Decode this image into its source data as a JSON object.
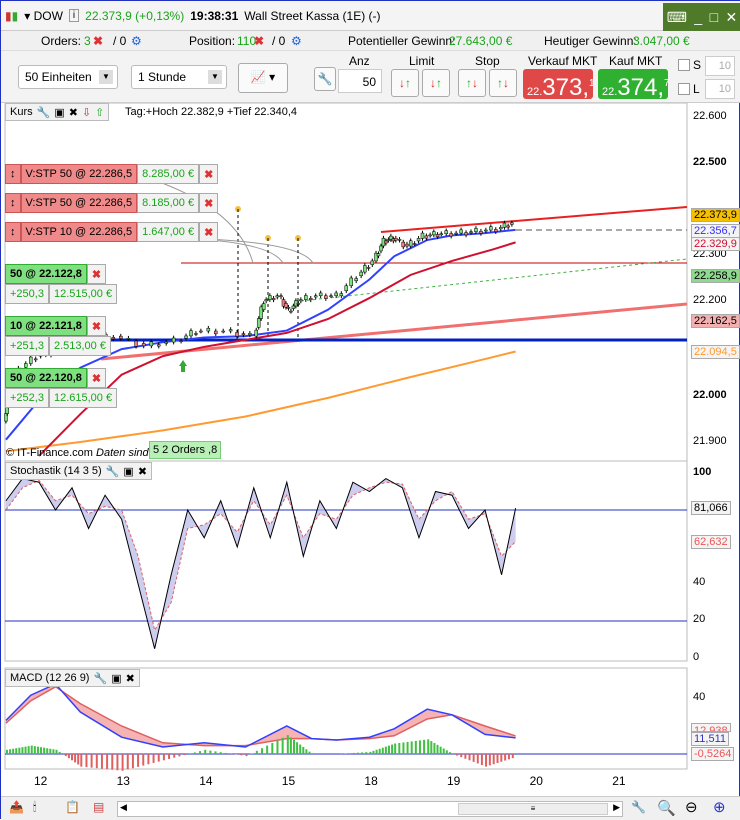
{
  "title": {
    "symbol": "DOW",
    "price": "22.373,9 (+0,13%)",
    "time": "19:38:31",
    "name": "Wall Street Kassa (1E) (-)"
  },
  "info": {
    "orders_label": "Orders:",
    "orders_count": "3",
    "orders_zero": "/ 0",
    "position_label": "Position:",
    "position_count": "110",
    "position_zero": "/ 0",
    "pot_label": "Potentieller Gewinn:",
    "pot_value": "27.643,00 €",
    "today_label": "Heutiger Gewinn:",
    "today_value": "3.047,00 €"
  },
  "toolbar": {
    "units": "50 Einheiten",
    "interval": "1 Stunde",
    "anz_label": "Anz",
    "anz_value": "50",
    "limit_label": "Limit",
    "stop_label": "Stop",
    "sell_label": "Verkauf MKT",
    "sell_pre": "22.",
    "sell_main": "373,",
    "sell_sup": "1",
    "buy_label": "Kauf MKT",
    "buy_pre": "22.",
    "buy_main": "374,",
    "buy_sup": "7",
    "s_label": "S",
    "s_value": "10",
    "l_label": "L",
    "l_value": "10"
  },
  "kurs": {
    "label": "Kurs",
    "info": "Tag:+Hoch 22.382,9 +Tief 22.340,4",
    "copyright": "© IT-Finance.com",
    "delay": "Daten sind indikativ",
    "orders_badge": "5 2 Orders",
    ",8": ",8"
  },
  "stop_orders": [
    {
      "label": "V:STP  50 @ 22.286,5",
      "value": "8.285,00 €"
    },
    {
      "label": "V:STP  50 @ 22.286,5",
      "value": "8.185,00 €"
    },
    {
      "label": "V:STP  10 @ 22.286,5",
      "value": "1.647,00 €"
    }
  ],
  "positions": [
    {
      "label": "50 @ 22.122,8",
      "pts": "+250,3",
      "value": "12.515,00 €"
    },
    {
      "label": "10 @ 22.121,8",
      "pts": "+251,3",
      "value": "2.513,00 €"
    },
    {
      "label": "50 @ 22.120,8",
      "pts": "+252,3",
      "value": "12.615,00 €"
    }
  ],
  "price_axis": {
    "ticks": [
      "22.600",
      "22.500",
      "22.300",
      "22.200",
      "22.000",
      "21.900"
    ],
    "badges": [
      {
        "v": "22.373,9",
        "c": "#f5c000",
        "t": "#000"
      },
      {
        "v": "22.356,7",
        "c": "#f4f4f4",
        "t": "#3030ff"
      },
      {
        "v": "22.329,9",
        "c": "#f4f4f4",
        "t": "#d01030"
      },
      {
        "v": "22.258,9",
        "c": "#8fd88f",
        "t": "#000"
      },
      {
        "v": "22.162,5",
        "c": "#f3b0b0",
        "t": "#000"
      },
      {
        "v": "22.094,5",
        "c": "#f4f4f4",
        "t": "#ff9a30"
      }
    ]
  },
  "stoch": {
    "label": "Stochastik (14 3 5)",
    "ticks": [
      "100",
      "40",
      "20",
      "0"
    ],
    "k": "81,066",
    "d": "62,632"
  },
  "macd": {
    "label": "MACD (12 26 9)",
    "tick": "40",
    "v1": "12,938",
    "v2": "11,511",
    "v3": "-0,5264"
  },
  "dates": [
    "12",
    "13",
    "14",
    "15",
    "18",
    "19",
    "20",
    "21"
  ],
  "chart_data": {
    "type": "line",
    "x_unit": "trading day index (12=0,13=1,14=2,15=3,18=4,19=5,20=6,21=7)",
    "price": {
      "x": [
        -0.4,
        -0.34,
        -0.22,
        0.02,
        0.27,
        0.63,
        0.99,
        1.36,
        1.72,
        1.96,
        2.32,
        2.63,
        2.75,
        2.93,
        3.05,
        3.17,
        3.41,
        3.66,
        3.9,
        4.08,
        4.2,
        4.32,
        4.5,
        4.69,
        4.87,
        5.11,
        5.35,
        5.59,
        5.77
      ],
      "y": [
        21945,
        22010,
        22053,
        22085,
        22096,
        22118,
        22128,
        22107,
        22118,
        22139,
        22139,
        22128,
        22204,
        22215,
        22182,
        22204,
        22215,
        22215,
        22258,
        22290,
        22333,
        22339,
        22322,
        22344,
        22348,
        22350,
        22354,
        22359,
        22372
      ]
    },
    "ma_blue": {
      "x": [
        -0.4,
        0,
        0.5,
        1,
        1.5,
        2,
        2.5,
        3,
        3.5,
        4,
        4.3,
        4.7,
        5,
        5.4,
        5.77
      ],
      "y": [
        21905,
        21990,
        22060,
        22100,
        22115,
        22125,
        22128,
        22140,
        22185,
        22250,
        22300,
        22335,
        22345,
        22350,
        22357
      ]
    },
    "ma_red": {
      "x": [
        0,
        0.5,
        1,
        1.5,
        2,
        2.5,
        3,
        3.5,
        4,
        4.5,
        5,
        5.5,
        5.77
      ],
      "y": [
        21870,
        21960,
        22045,
        22085,
        22105,
        22120,
        22135,
        22165,
        22210,
        22260,
        22290,
        22315,
        22330
      ]
    },
    "ma_orange": {
      "x": [
        -0.4,
        0.5,
        1.5,
        2.5,
        3.5,
        4.5,
        5.2,
        5.77
      ],
      "y": [
        21880,
        21900,
        21925,
        21955,
        21995,
        22040,
        22070,
        22095
      ]
    },
    "stoch_k": {
      "x": [
        -0.4,
        -0.2,
        0,
        0.2,
        0.4,
        0.6,
        0.8,
        1.0,
        1.2,
        1.4,
        1.6,
        1.8,
        2.0,
        2.2,
        2.4,
        2.6,
        2.8,
        3.0,
        3.2,
        3.4,
        3.6,
        3.8,
        4.0,
        4.2,
        4.4,
        4.6,
        4.8,
        5.0,
        5.2,
        5.4,
        5.6,
        5.77
      ],
      "y": [
        85,
        97,
        95,
        80,
        92,
        70,
        88,
        75,
        40,
        5,
        45,
        80,
        65,
        85,
        60,
        92,
        65,
        95,
        55,
        85,
        70,
        95,
        90,
        97,
        92,
        65,
        90,
        88,
        70,
        80,
        45,
        81
      ]
    },
    "stoch_d": {
      "x": [
        -0.4,
        -0.2,
        0,
        0.2,
        0.4,
        0.6,
        0.8,
        1.0,
        1.2,
        1.4,
        1.6,
        1.8,
        2.0,
        2.2,
        2.4,
        2.6,
        2.8,
        3.0,
        3.2,
        3.4,
        3.6,
        3.8,
        4.0,
        4.2,
        4.4,
        4.6,
        4.8,
        5.0,
        5.2,
        5.4,
        5.6,
        5.77
      ],
      "y": [
        80,
        92,
        96,
        85,
        88,
        78,
        82,
        80,
        55,
        15,
        30,
        70,
        72,
        78,
        68,
        85,
        72,
        88,
        65,
        78,
        75,
        88,
        92,
        95,
        94,
        75,
        85,
        90,
        75,
        78,
        55,
        63
      ]
    },
    "stoch_levels": [
      80,
      20
    ],
    "macd_line": {
      "x": [
        -0.4,
        -0.1,
        0.2,
        0.5,
        1,
        1.5,
        2,
        2.5,
        3,
        3.3,
        3.6,
        4,
        4.3,
        4.7,
        5,
        5.4,
        5.77
      ],
      "y": [
        24,
        42,
        50,
        30,
        12,
        5,
        8,
        5,
        20,
        11,
        10,
        12,
        18,
        32,
        28,
        14,
        11.5
      ]
    },
    "signal_line": {
      "x": [
        -0.4,
        -0.1,
        0.2,
        0.5,
        1,
        1.5,
        2,
        2.5,
        3,
        3.3,
        3.6,
        4,
        4.3,
        4.7,
        5,
        5.4,
        5.77
      ],
      "y": [
        22,
        38,
        48,
        36,
        20,
        8,
        6,
        6,
        11,
        11,
        10,
        11,
        13,
        25,
        28,
        20,
        12.9
      ]
    }
  }
}
